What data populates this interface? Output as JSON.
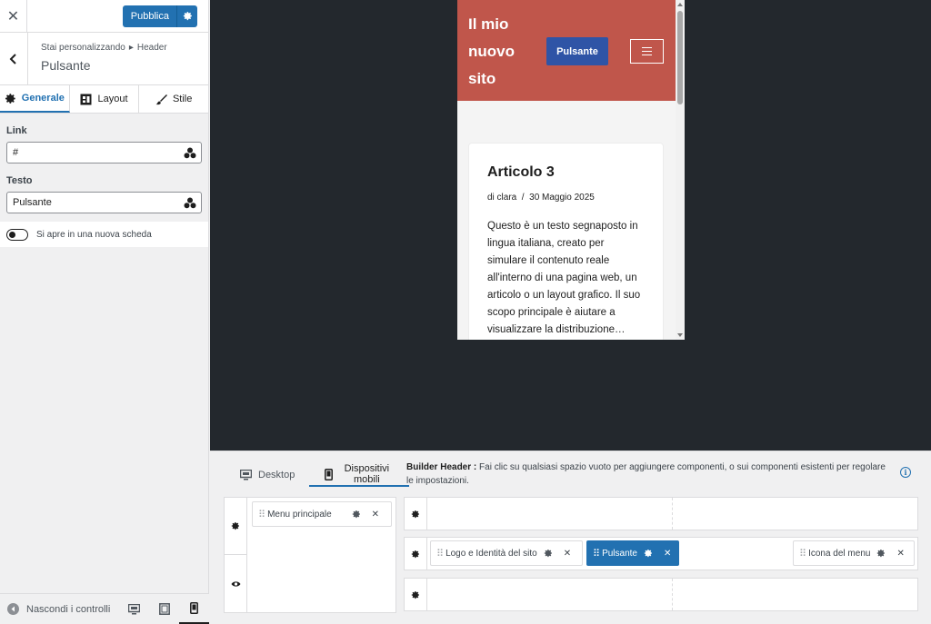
{
  "sidebar": {
    "publish_label": "Pubblica",
    "breadcrumb_prefix": "Stai personalizzando",
    "breadcrumb_arrow": "▸",
    "breadcrumb_section": "Header",
    "title": "Pulsante",
    "tabs": [
      {
        "label": "Generale",
        "icon": "gear-icon",
        "active": true
      },
      {
        "label": "Layout",
        "icon": "layout-icon",
        "active": false
      },
      {
        "label": "Stile",
        "icon": "brush-icon",
        "active": false
      }
    ],
    "link_label": "Link",
    "link_value": "#",
    "text_label": "Testo",
    "text_value": "Pulsante",
    "toggle_label": "Si apre in una nuova scheda",
    "toggle_on": false,
    "hide_controls_label": "Nascondi i controlli",
    "active_device": "mobile"
  },
  "preview": {
    "site_title": "Il mio nuovo sito",
    "header_button": "Pulsante",
    "header_color": "#c0564b",
    "button_color": "#2f54a6",
    "article_title": "Articolo 3",
    "article_meta": "di clara  /  30 Maggio 2025",
    "article_excerpt": "Questo è un testo segnaposto in lingua italiana, creato per simulare il contenuto reale all'interno di una pagina web, un articolo o un layout grafico. Il suo scopo principale è aiutare a visualizzare la distribuzione…"
  },
  "builder": {
    "tab_desktop": "Desktop",
    "tab_mobile": "Dispositivi mobili",
    "info_bold": "Builder Header :",
    "info_text": " Fai clic su qualsiasi spazio vuoto per aggiungere componenti, o sui componenti esistenti per regolare le impostazioni.",
    "offcanvas_item": "Menu principale",
    "main_row_items": {
      "logo": "Logo e Identità del sito",
      "button": "Pulsante",
      "menu_icon": "Icona del menu"
    },
    "accent_color": "#2271b1"
  }
}
